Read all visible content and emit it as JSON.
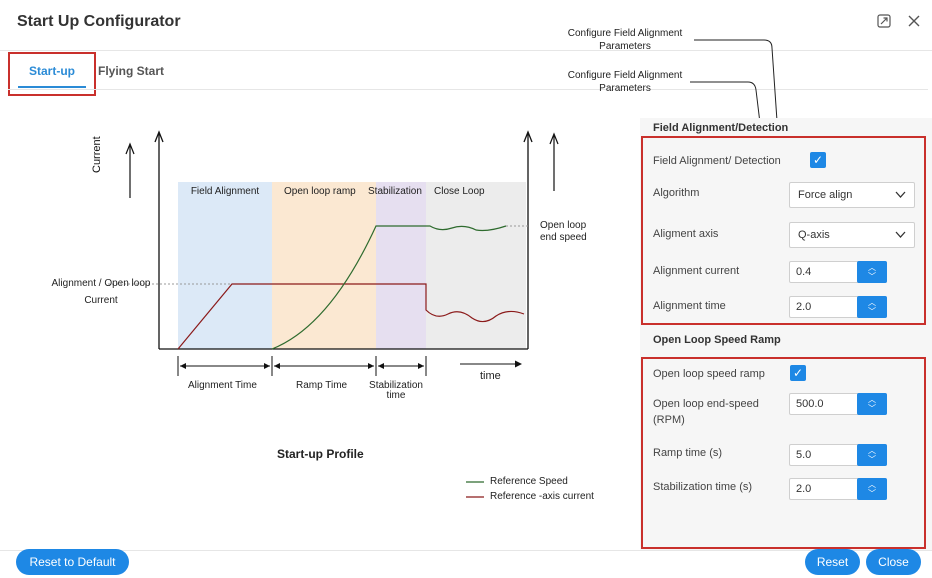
{
  "window": {
    "title": "Start Up Configurator",
    "expand_icon": "expand-icon",
    "close_icon": "close-icon"
  },
  "tabs": [
    {
      "label": "Start-up",
      "active": true
    },
    {
      "label": "Flying Start",
      "active": false
    }
  ],
  "callouts": [
    "Configure Field Alignment Parameters",
    "Configure Field Alignment Parameters"
  ],
  "diagram": {
    "y_axis_label": "Current",
    "phases": [
      "Field Alignment",
      "Open loop ramp",
      "Stabilization",
      "Close Loop"
    ],
    "left_label": "Alignment / Open loop Current",
    "right_label": "Open loop end speed",
    "time_labels": [
      "Alignment Time",
      "Ramp Time",
      "Stabilization time"
    ],
    "x_axis_label": "time",
    "caption": "Start-up Profile",
    "legend": [
      {
        "label": "Reference Speed",
        "color": "#2e6b2e"
      },
      {
        "label": "Reference -axis current",
        "color": "#8b1a1a"
      }
    ],
    "phase_colors": [
      "#dce9f7",
      "#fbe8d2",
      "#e6dff0",
      "#ececec"
    ]
  },
  "field_alignment": {
    "section_title": "Field Alignment/Detection",
    "enable_label": "Field Alignment/ Detection",
    "enabled": true,
    "algorithm_label": "Algorithm",
    "algorithm_value": "Force align",
    "axis_label": "Aligment axis",
    "axis_value": "Q-axis",
    "current_label": "Alignment current",
    "current_value": "0.4",
    "time_label": "Alignment time",
    "time_value": "2.0"
  },
  "open_loop": {
    "section_title": "Open Loop Speed Ramp",
    "enable_label": "Open loop speed ramp",
    "enabled": true,
    "end_speed_label_1": "Open loop end-speed",
    "end_speed_label_2": "(RPM)",
    "end_speed_value": "500.0",
    "ramp_time_label": "Ramp time (s)",
    "ramp_time_value": "5.0",
    "stab_time_label": "Stabilization time (s)",
    "stab_time_value": "2.0"
  },
  "footer": {
    "reset_default": "Reset to Default",
    "reset": "Reset",
    "close": "Close"
  },
  "colors": {
    "accent": "#1e88e5",
    "highlight_box": "#c9302c"
  }
}
